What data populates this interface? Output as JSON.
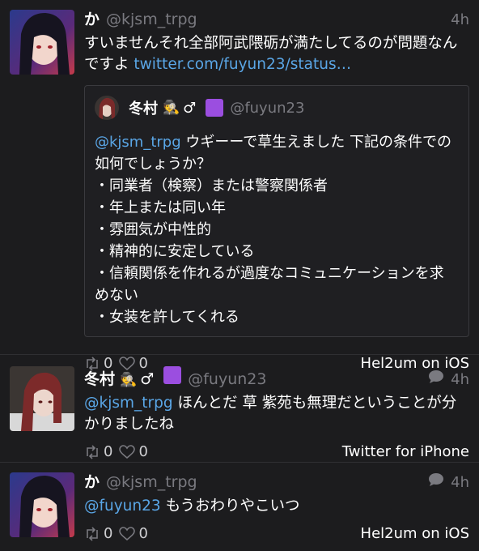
{
  "tweets": [
    {
      "name": "か",
      "handle": "@kjsm_trpg",
      "time": "4h",
      "body_text": "すいませんそれ全部阿武隈砺が満たしてるのが問題なんですよ ",
      "link": "twitter.com/fuyun23/status…",
      "quote": {
        "name": "冬村",
        "name_emoji": "🕵",
        "gender": "♂",
        "handle": "@fuyun23",
        "mention": "@kjsm_trpg",
        "first_text": " ウギーーで草生えました 下記の条件での如何でしょうか？",
        "lines": [
          "・同業者（検察）または警察関係者",
          "・年上または同い年",
          "・雰囲気が中性的",
          "・精神的に安定している",
          "・信頼関係を作れるが過度なコミュニケーションを求めない",
          "・女装を許してくれる"
        ]
      },
      "retweets": "0",
      "likes": "0",
      "client": "Hel2um on iOS"
    },
    {
      "name": "冬村",
      "name_emoji": "🕵",
      "gender": "♂",
      "handle": "@fuyun23",
      "time": "4h",
      "mention": "@kjsm_trpg",
      "body_text": " ほんとだ 草 紫苑も無理だということが分かりましたね",
      "retweets": "0",
      "likes": "0",
      "client": "Twitter for iPhone"
    },
    {
      "name": "か",
      "handle": "@kjsm_trpg",
      "time": "4h",
      "mention": "@fuyun23",
      "body_text": " もうおわりやこいつ",
      "retweets": "0",
      "likes": "0",
      "client": "Hel2um on iOS"
    }
  ],
  "icons": {
    "retweet": "retweet-icon",
    "like": "heart-icon",
    "reply": "reply-bubble-icon",
    "badge": "purple-square"
  },
  "colors": {
    "background": "#1c1c1e",
    "link": "#5aa6e6",
    "muted": "#7a7a80",
    "badge": "#9b4ee0"
  }
}
